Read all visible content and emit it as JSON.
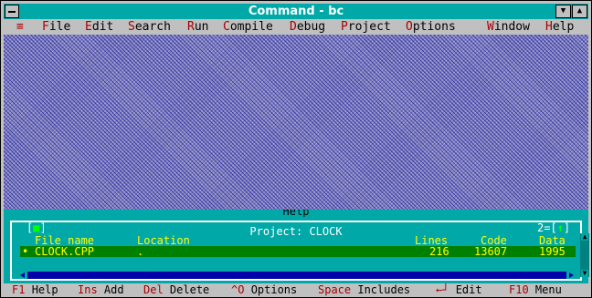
{
  "window": {
    "title": "Command - bc"
  },
  "menu": {
    "items": [
      {
        "hot": "≡",
        "rest": ""
      },
      {
        "hot": "F",
        "rest": "ile"
      },
      {
        "hot": "E",
        "rest": "dit"
      },
      {
        "hot": "S",
        "rest": "earch"
      },
      {
        "hot": "R",
        "rest": "un"
      },
      {
        "hot": "C",
        "rest": "ompile"
      },
      {
        "hot": "D",
        "rest": "ebug"
      },
      {
        "hot": "P",
        "rest": "roject"
      },
      {
        "hot": "O",
        "rest": "ptions"
      },
      {
        "hot": "W",
        "rest": "indow"
      },
      {
        "hot": "H",
        "rest": "elp"
      }
    ]
  },
  "help_strip": {
    "title": "Help"
  },
  "project": {
    "title": "Project: CLOCK",
    "window_number": "2",
    "close_glyph": "■",
    "zoom_glyph": "↑",
    "columns": {
      "file_name": "File name",
      "location": "Location",
      "lines": "Lines",
      "code": "Code",
      "data": "Data"
    },
    "rows": [
      {
        "file_name": "CLOCK.CPP",
        "location": ".",
        "lines": "216",
        "code": "13607",
        "data": "1995"
      }
    ]
  },
  "status": {
    "items": [
      {
        "key": "F1",
        "label": "Help"
      },
      {
        "key": "Ins",
        "label": "Add"
      },
      {
        "key": "Del",
        "label": "Delete"
      },
      {
        "key": "^O",
        "label": "Options"
      },
      {
        "key": "Space",
        "label": "Includes"
      },
      {
        "key": "←┘",
        "label": "Edit"
      },
      {
        "key": "F10",
        "label": "Menu"
      }
    ]
  },
  "colors": {
    "title_bar": "#00a8a8",
    "menu_hotkey": "#a80000",
    "project_bg": "#00a8a8",
    "selection_bg": "#008000",
    "selection_text": "#ffff00"
  }
}
